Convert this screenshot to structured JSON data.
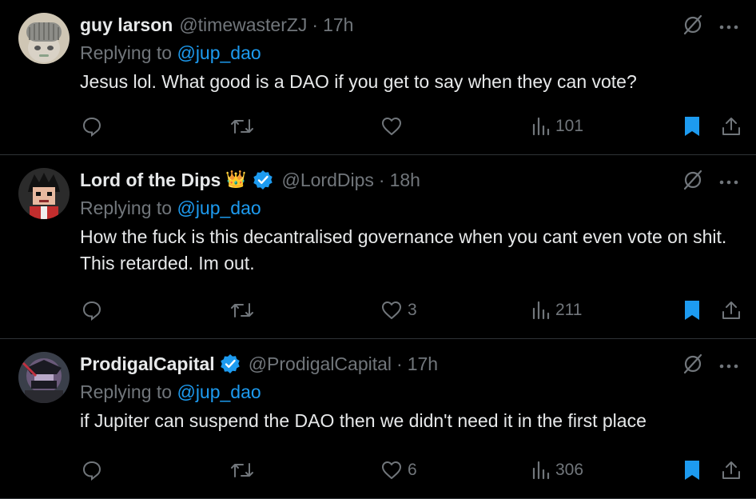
{
  "tweets": [
    {
      "name": "guy larson",
      "handle": "@timewasterZJ",
      "separator": "·",
      "time": "17h",
      "replying_prefix": "Replying to ",
      "replying_to": "@jup_dao",
      "text": "Jesus lol. What good is a DAO if you get to say when they can vote?",
      "likes": "",
      "views": "101",
      "emoji": "",
      "verified": false
    },
    {
      "name": "Lord of the Dips",
      "handle": "@LordDips",
      "separator": "·",
      "time": "18h",
      "replying_prefix": "Replying to ",
      "replying_to": "@jup_dao",
      "text": "How the fuck is this decantralised governance when you cant even vote on shit. This retarded. Im out.",
      "likes": "3",
      "views": "211",
      "emoji": "👑",
      "verified": true
    },
    {
      "name": "ProdigalCapital",
      "handle": "@ProdigalCapital",
      "separator": "·",
      "time": "17h",
      "replying_prefix": "Replying to ",
      "replying_to": "@jup_dao",
      "text": "if Jupiter can suspend the DAO then we didn't need it in the first place",
      "likes": "6",
      "views": "306",
      "emoji": "",
      "verified": true
    }
  ],
  "icons": {
    "grok": "grok-slash-icon",
    "more": "more-icon",
    "reply": "reply-icon",
    "retweet": "retweet-icon",
    "like": "heart-icon",
    "views": "views-icon",
    "bookmark": "bookmark-icon",
    "share": "share-icon",
    "verified": "verified-badge-icon"
  },
  "colors": {
    "background": "#000000",
    "text": "#e7e9ea",
    "muted": "#71767b",
    "link": "#1d9bf0",
    "bookmark": "#1d9bf0",
    "divider": "#2f3336"
  }
}
